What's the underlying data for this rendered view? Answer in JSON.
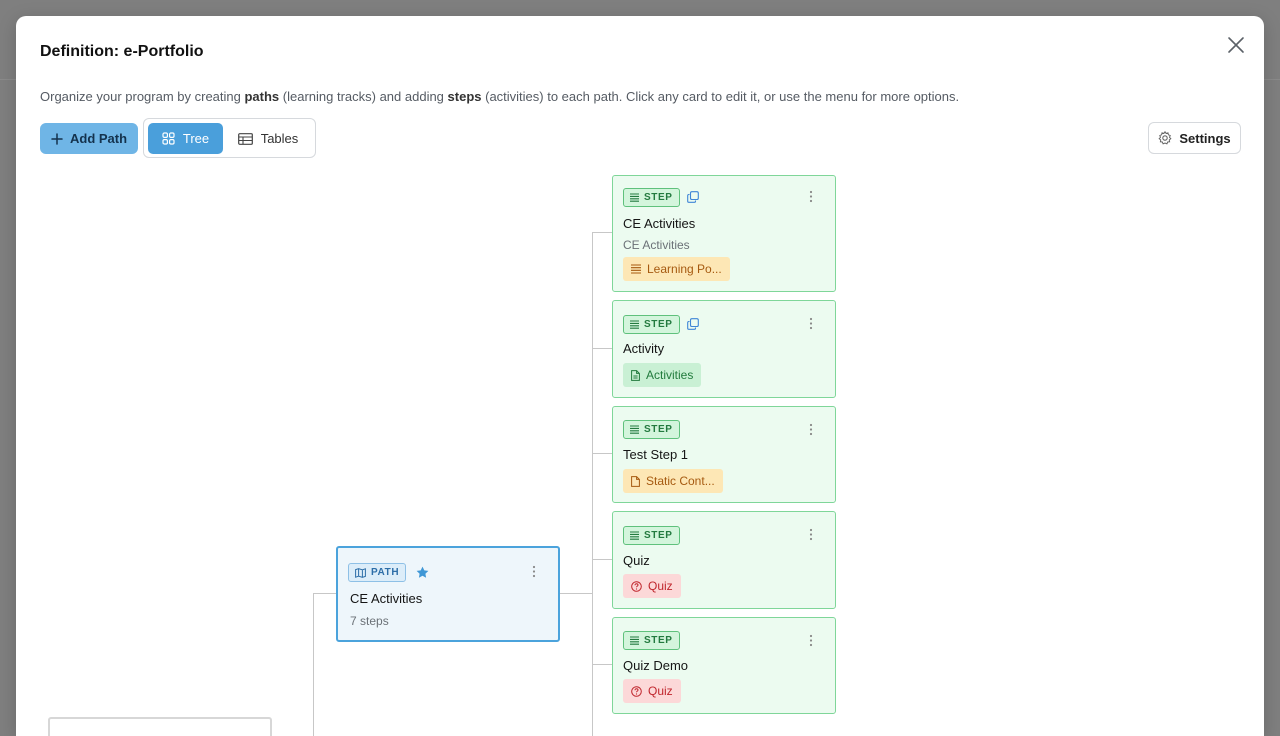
{
  "modal": {
    "title": "Definition: e-Portfolio",
    "description": {
      "t1": "Organize your program by creating ",
      "b1": "paths",
      "t2": " (learning tracks) and adding ",
      "b2": "steps",
      "t3": " (activities) to each path. Click any card to edit it, or use the menu for more options."
    }
  },
  "toolbar": {
    "add_path_label": "Add Path",
    "tree_label": "Tree",
    "tables_label": "Tables",
    "settings_label": "Settings"
  },
  "path": {
    "badge": "PATH",
    "title": "CE Activities",
    "subtitle": "7 steps",
    "starred": true
  },
  "steps": [
    {
      "badge": "STEP",
      "title": "CE Activities",
      "subtitle": "CE Activities",
      "tag": "Learning Po...",
      "tag_color": "orange",
      "tag_icon": "list-icon",
      "has_copy": true
    },
    {
      "badge": "STEP",
      "title": "Activity",
      "tag": "Activities",
      "tag_color": "green",
      "tag_icon": "document-icon",
      "has_copy": true
    },
    {
      "badge": "STEP",
      "title": "Test Step 1",
      "tag": "Static Cont...",
      "tag_color": "orange",
      "tag_icon": "document-icon",
      "has_copy": false
    },
    {
      "badge": "STEP",
      "title": "Quiz",
      "tag": "Quiz",
      "tag_color": "red",
      "tag_icon": "question-circle-icon",
      "has_copy": false
    },
    {
      "badge": "STEP",
      "title": "Quiz Demo",
      "tag": "Quiz",
      "tag_color": "red",
      "tag_icon": "question-circle-icon",
      "has_copy": false
    }
  ],
  "colors": {
    "primary_button": "#6fb5e6",
    "active_toggle": "#4a9fdb",
    "step_card_bg": "#ecfbf0",
    "step_card_border": "#7fd699",
    "path_card_border": "#4ba3dc"
  }
}
